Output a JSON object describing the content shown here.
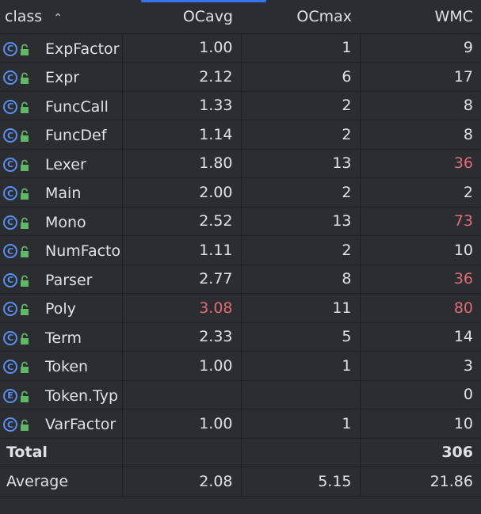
{
  "header": {
    "col_class": "class",
    "col_ocavg": "OCavg",
    "col_ocmax": "OCmax",
    "col_wmc": "WMC",
    "sort_icon": "chevron-up-icon"
  },
  "colors": {
    "accent": "#3574f0",
    "warning_red": "#e06c75",
    "icon_blue": "#5a8ff0",
    "lock_green": "#5fb865"
  },
  "rows": [
    {
      "kind": "C",
      "name": "ExpFactor",
      "ocavg": "1.00",
      "ocmax": "1",
      "wmc": "9",
      "red_ocavg": false,
      "red_wmc": false
    },
    {
      "kind": "C",
      "name": "Expr",
      "ocavg": "2.12",
      "ocmax": "6",
      "wmc": "17",
      "red_ocavg": false,
      "red_wmc": false
    },
    {
      "kind": "C",
      "name": "FuncCall",
      "ocavg": "1.33",
      "ocmax": "2",
      "wmc": "8",
      "red_ocavg": false,
      "red_wmc": false
    },
    {
      "kind": "C",
      "name": "FuncDef",
      "ocavg": "1.14",
      "ocmax": "2",
      "wmc": "8",
      "red_ocavg": false,
      "red_wmc": false
    },
    {
      "kind": "C",
      "name": "Lexer",
      "ocavg": "1.80",
      "ocmax": "13",
      "wmc": "36",
      "red_ocavg": false,
      "red_wmc": true
    },
    {
      "kind": "C",
      "name": "Main",
      "ocavg": "2.00",
      "ocmax": "2",
      "wmc": "2",
      "red_ocavg": false,
      "red_wmc": false
    },
    {
      "kind": "C",
      "name": "Mono",
      "ocavg": "2.52",
      "ocmax": "13",
      "wmc": "73",
      "red_ocavg": false,
      "red_wmc": true
    },
    {
      "kind": "C",
      "name": "NumFacto",
      "ocavg": "1.11",
      "ocmax": "2",
      "wmc": "10",
      "red_ocavg": false,
      "red_wmc": false
    },
    {
      "kind": "C",
      "name": "Parser",
      "ocavg": "2.77",
      "ocmax": "8",
      "wmc": "36",
      "red_ocavg": false,
      "red_wmc": true
    },
    {
      "kind": "C",
      "name": "Poly",
      "ocavg": "3.08",
      "ocmax": "11",
      "wmc": "80",
      "red_ocavg": true,
      "red_wmc": true
    },
    {
      "kind": "C",
      "name": "Term",
      "ocavg": "2.33",
      "ocmax": "5",
      "wmc": "14",
      "red_ocavg": false,
      "red_wmc": false
    },
    {
      "kind": "C",
      "name": "Token",
      "ocavg": "1.00",
      "ocmax": "1",
      "wmc": "3",
      "red_ocavg": false,
      "red_wmc": false
    },
    {
      "kind": "E",
      "name": "Token.Typ",
      "ocavg": "",
      "ocmax": "",
      "wmc": "0",
      "red_ocavg": false,
      "red_wmc": false
    },
    {
      "kind": "C",
      "name": "VarFactor",
      "ocavg": "1.00",
      "ocmax": "1",
      "wmc": "10",
      "red_ocavg": false,
      "red_wmc": false
    }
  ],
  "total": {
    "label": "Total",
    "ocavg": "",
    "ocmax": "",
    "wmc": "306"
  },
  "average": {
    "label": "Average",
    "ocavg": "2.08",
    "ocmax": "5.15",
    "wmc": "21.86"
  }
}
